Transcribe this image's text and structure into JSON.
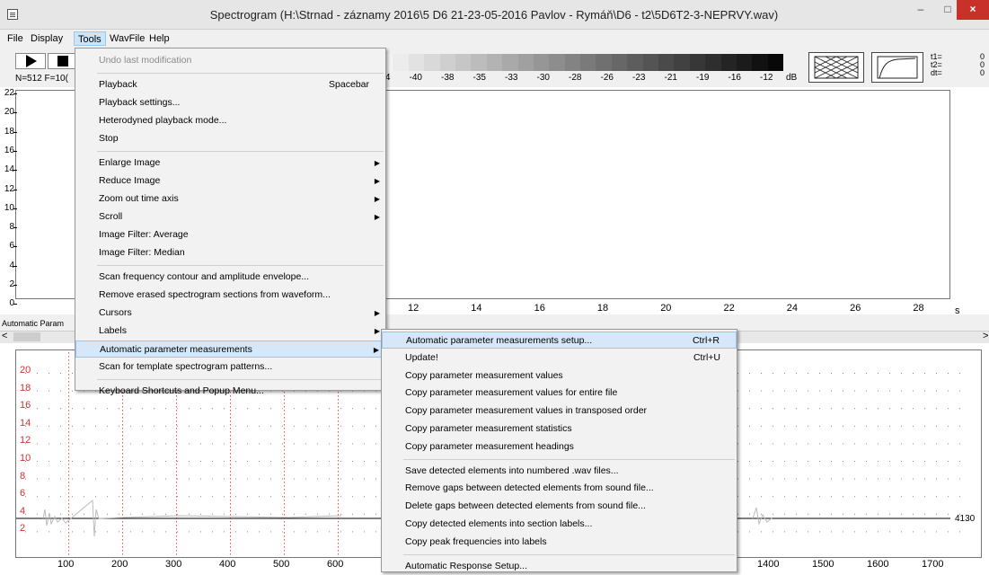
{
  "window": {
    "title": "Spectrogram (H:\\Strnad - záznamy 2016\\5 D6 21-23-05-2016 Pavlov - Rymáň\\D6 - t2\\5D6T2-3-NEPRVY.wav)",
    "minimize": "–",
    "maximize": "□",
    "close": "×"
  },
  "menubar": [
    "File",
    "Display",
    "Tools",
    "WavFile",
    "Help"
  ],
  "toolbar": {
    "nf_readout": "N=512 F=10(",
    "db_labels": [
      "-44",
      "-40",
      "-38",
      "-35",
      "-33",
      "-30",
      "-28",
      "-26",
      "-23",
      "-21",
      "-19",
      "-16",
      "-12"
    ],
    "db_unit": "dB",
    "time_readouts": [
      {
        "label": "t1=",
        "value": "0"
      },
      {
        "label": "t2=",
        "value": "0"
      },
      {
        "label": "dt=",
        "value": "0"
      }
    ]
  },
  "spectrogram": {
    "y_ticks": [
      "22",
      "20",
      "18",
      "16",
      "14",
      "12",
      "10",
      "8",
      "6",
      "4",
      "2",
      "0"
    ],
    "x_ticks": [
      "12",
      "14",
      "16",
      "18",
      "20",
      "22",
      "24",
      "26",
      "28"
    ],
    "time_unit": "s"
  },
  "status": {
    "tab_label": "Automatic Param",
    "scroll_left": "<",
    "scroll_right": ">"
  },
  "lower_panel": {
    "y_labels": [
      "20",
      "18",
      "16",
      "14",
      "12",
      "10",
      "8",
      "6",
      "4",
      "2"
    ],
    "x_labels_left": [
      "100",
      "200",
      "300",
      "400",
      "500",
      "600"
    ],
    "x_labels_right": [
      "1400",
      "1500",
      "1600",
      "1700"
    ],
    "readout": "4130"
  },
  "tools_menu": {
    "items": [
      {
        "label": "Undo last modification",
        "disabled": true
      },
      {
        "sep": true
      },
      {
        "label": "Playback",
        "shortcut": "Spacebar"
      },
      {
        "label": "Playback settings..."
      },
      {
        "label": "Heterodyned playback mode..."
      },
      {
        "label": "Stop"
      },
      {
        "sep": true
      },
      {
        "label": "Enlarge Image",
        "submenu": true
      },
      {
        "label": "Reduce Image",
        "submenu": true
      },
      {
        "label": "Zoom out time axis",
        "submenu": true
      },
      {
        "label": "Scroll",
        "submenu": true
      },
      {
        "label": "Image Filter: Average"
      },
      {
        "label": "Image Filter: Median"
      },
      {
        "sep": true
      },
      {
        "label": "Scan frequency contour and amplitude envelope..."
      },
      {
        "label": "Remove erased spectrogram sections from waveform..."
      },
      {
        "label": "Cursors",
        "submenu": true
      },
      {
        "label": "Labels",
        "submenu": true
      },
      {
        "label": "Automatic parameter measurements",
        "submenu": true,
        "highlighted": true
      },
      {
        "label": "Scan for template spectrogram patterns..."
      },
      {
        "sep": true
      },
      {
        "label": "Keyboard Shortcuts and Popup Menu..."
      }
    ]
  },
  "submenu": {
    "items": [
      {
        "label": "Automatic parameter measurements setup...",
        "shortcut": "Ctrl+R",
        "highlighted": true
      },
      {
        "label": "Update!",
        "shortcut": "Ctrl+U"
      },
      {
        "label": "Copy parameter measurement values"
      },
      {
        "label": "Copy parameter measurement values for entire file"
      },
      {
        "label": "Copy parameter measurement values in transposed order"
      },
      {
        "label": "Copy parameter measurement statistics"
      },
      {
        "label": "Copy parameter measurement headings"
      },
      {
        "sep": true
      },
      {
        "label": "Save detected elements into numbered .wav files..."
      },
      {
        "label": "Remove gaps between detected elements from sound file..."
      },
      {
        "label": "Delete gaps between detected elements from sound file..."
      },
      {
        "label": "Copy detected elements into section labels..."
      },
      {
        "label": "Copy peak frequencies into labels"
      },
      {
        "sep": true
      },
      {
        "label": "Automatic Response Setup..."
      }
    ]
  }
}
